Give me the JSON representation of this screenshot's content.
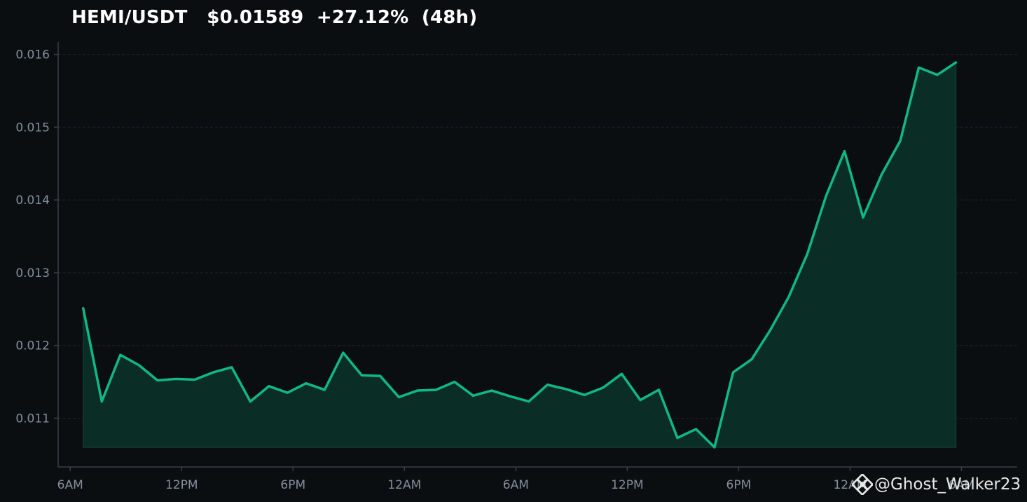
{
  "header": {
    "title": "HEMI/USDT   $0.01589  +27.12%  (48h)"
  },
  "watermark": {
    "text": "@Ghost_Walker23",
    "icon": "binance-logo-icon"
  },
  "colors": {
    "background": "#0b0e11",
    "line": "#10b981",
    "fill": "#0a2e26",
    "axis": "#3a3f47",
    "tick_label": "#848e9c",
    "grid": "#1f242b"
  },
  "chart_data": {
    "type": "area",
    "title": "HEMI/USDT   $0.01589  +27.12%  (48h)",
    "xlabel": "",
    "ylabel": "",
    "grid": "horizontal dashed",
    "x_unit_note": "hours",
    "x": [
      0.7,
      1.7,
      2.7,
      3.7,
      4.7,
      5.7,
      6.7,
      7.7,
      8.7,
      9.7,
      10.7,
      11.7,
      12.7,
      13.7,
      14.7,
      15.7,
      16.7,
      17.7,
      18.7,
      19.7,
      20.7,
      21.7,
      22.7,
      23.7,
      24.7,
      25.7,
      26.7,
      27.7,
      28.7,
      29.7,
      30.7,
      31.7,
      32.7,
      33.7,
      34.7,
      35.7,
      36.7,
      37.7,
      38.7,
      39.7,
      40.7,
      41.7,
      42.7,
      43.7,
      44.7,
      45.7,
      46.7,
      47.7
    ],
    "values": [
      0.01251,
      0.01123,
      0.01187,
      0.01173,
      0.01152,
      0.01154,
      0.01153,
      0.01163,
      0.0117,
      0.01123,
      0.01144,
      0.01135,
      0.01148,
      0.01139,
      0.0119,
      0.01159,
      0.01158,
      0.01129,
      0.01138,
      0.01139,
      0.0115,
      0.01131,
      0.01138,
      0.0113,
      0.01123,
      0.01146,
      0.0114,
      0.01132,
      0.01142,
      0.01161,
      0.01125,
      0.01139,
      0.01073,
      0.01085,
      0.0106,
      0.01163,
      0.01181,
      0.01221,
      0.01267,
      0.01326,
      0.01405,
      0.01467,
      0.01376,
      0.01435,
      0.01481,
      0.01582,
      0.01572,
      0.01589
    ],
    "xlim": [
      -0.65,
      51.0
    ],
    "ylim": [
      0.01033,
      0.01617
    ],
    "x_ticks": [
      {
        "x": 0,
        "label": "6AM"
      },
      {
        "x": 6,
        "label": "12PM"
      },
      {
        "x": 12,
        "label": "6PM"
      },
      {
        "x": 18,
        "label": "12AM"
      },
      {
        "x": 24,
        "label": "6AM"
      },
      {
        "x": 30,
        "label": "12PM"
      },
      {
        "x": 36,
        "label": "6PM"
      },
      {
        "x": 42,
        "label": "12AM"
      },
      {
        "x": 48,
        "label": "6AM"
      }
    ],
    "y_ticks": [
      {
        "y": 0.011,
        "label": "0.011"
      },
      {
        "y": 0.012,
        "label": "0.012"
      },
      {
        "y": 0.013,
        "label": "0.013"
      },
      {
        "y": 0.014,
        "label": "0.014"
      },
      {
        "y": 0.015,
        "label": "0.015"
      },
      {
        "y": 0.016,
        "label": "0.016"
      }
    ]
  }
}
